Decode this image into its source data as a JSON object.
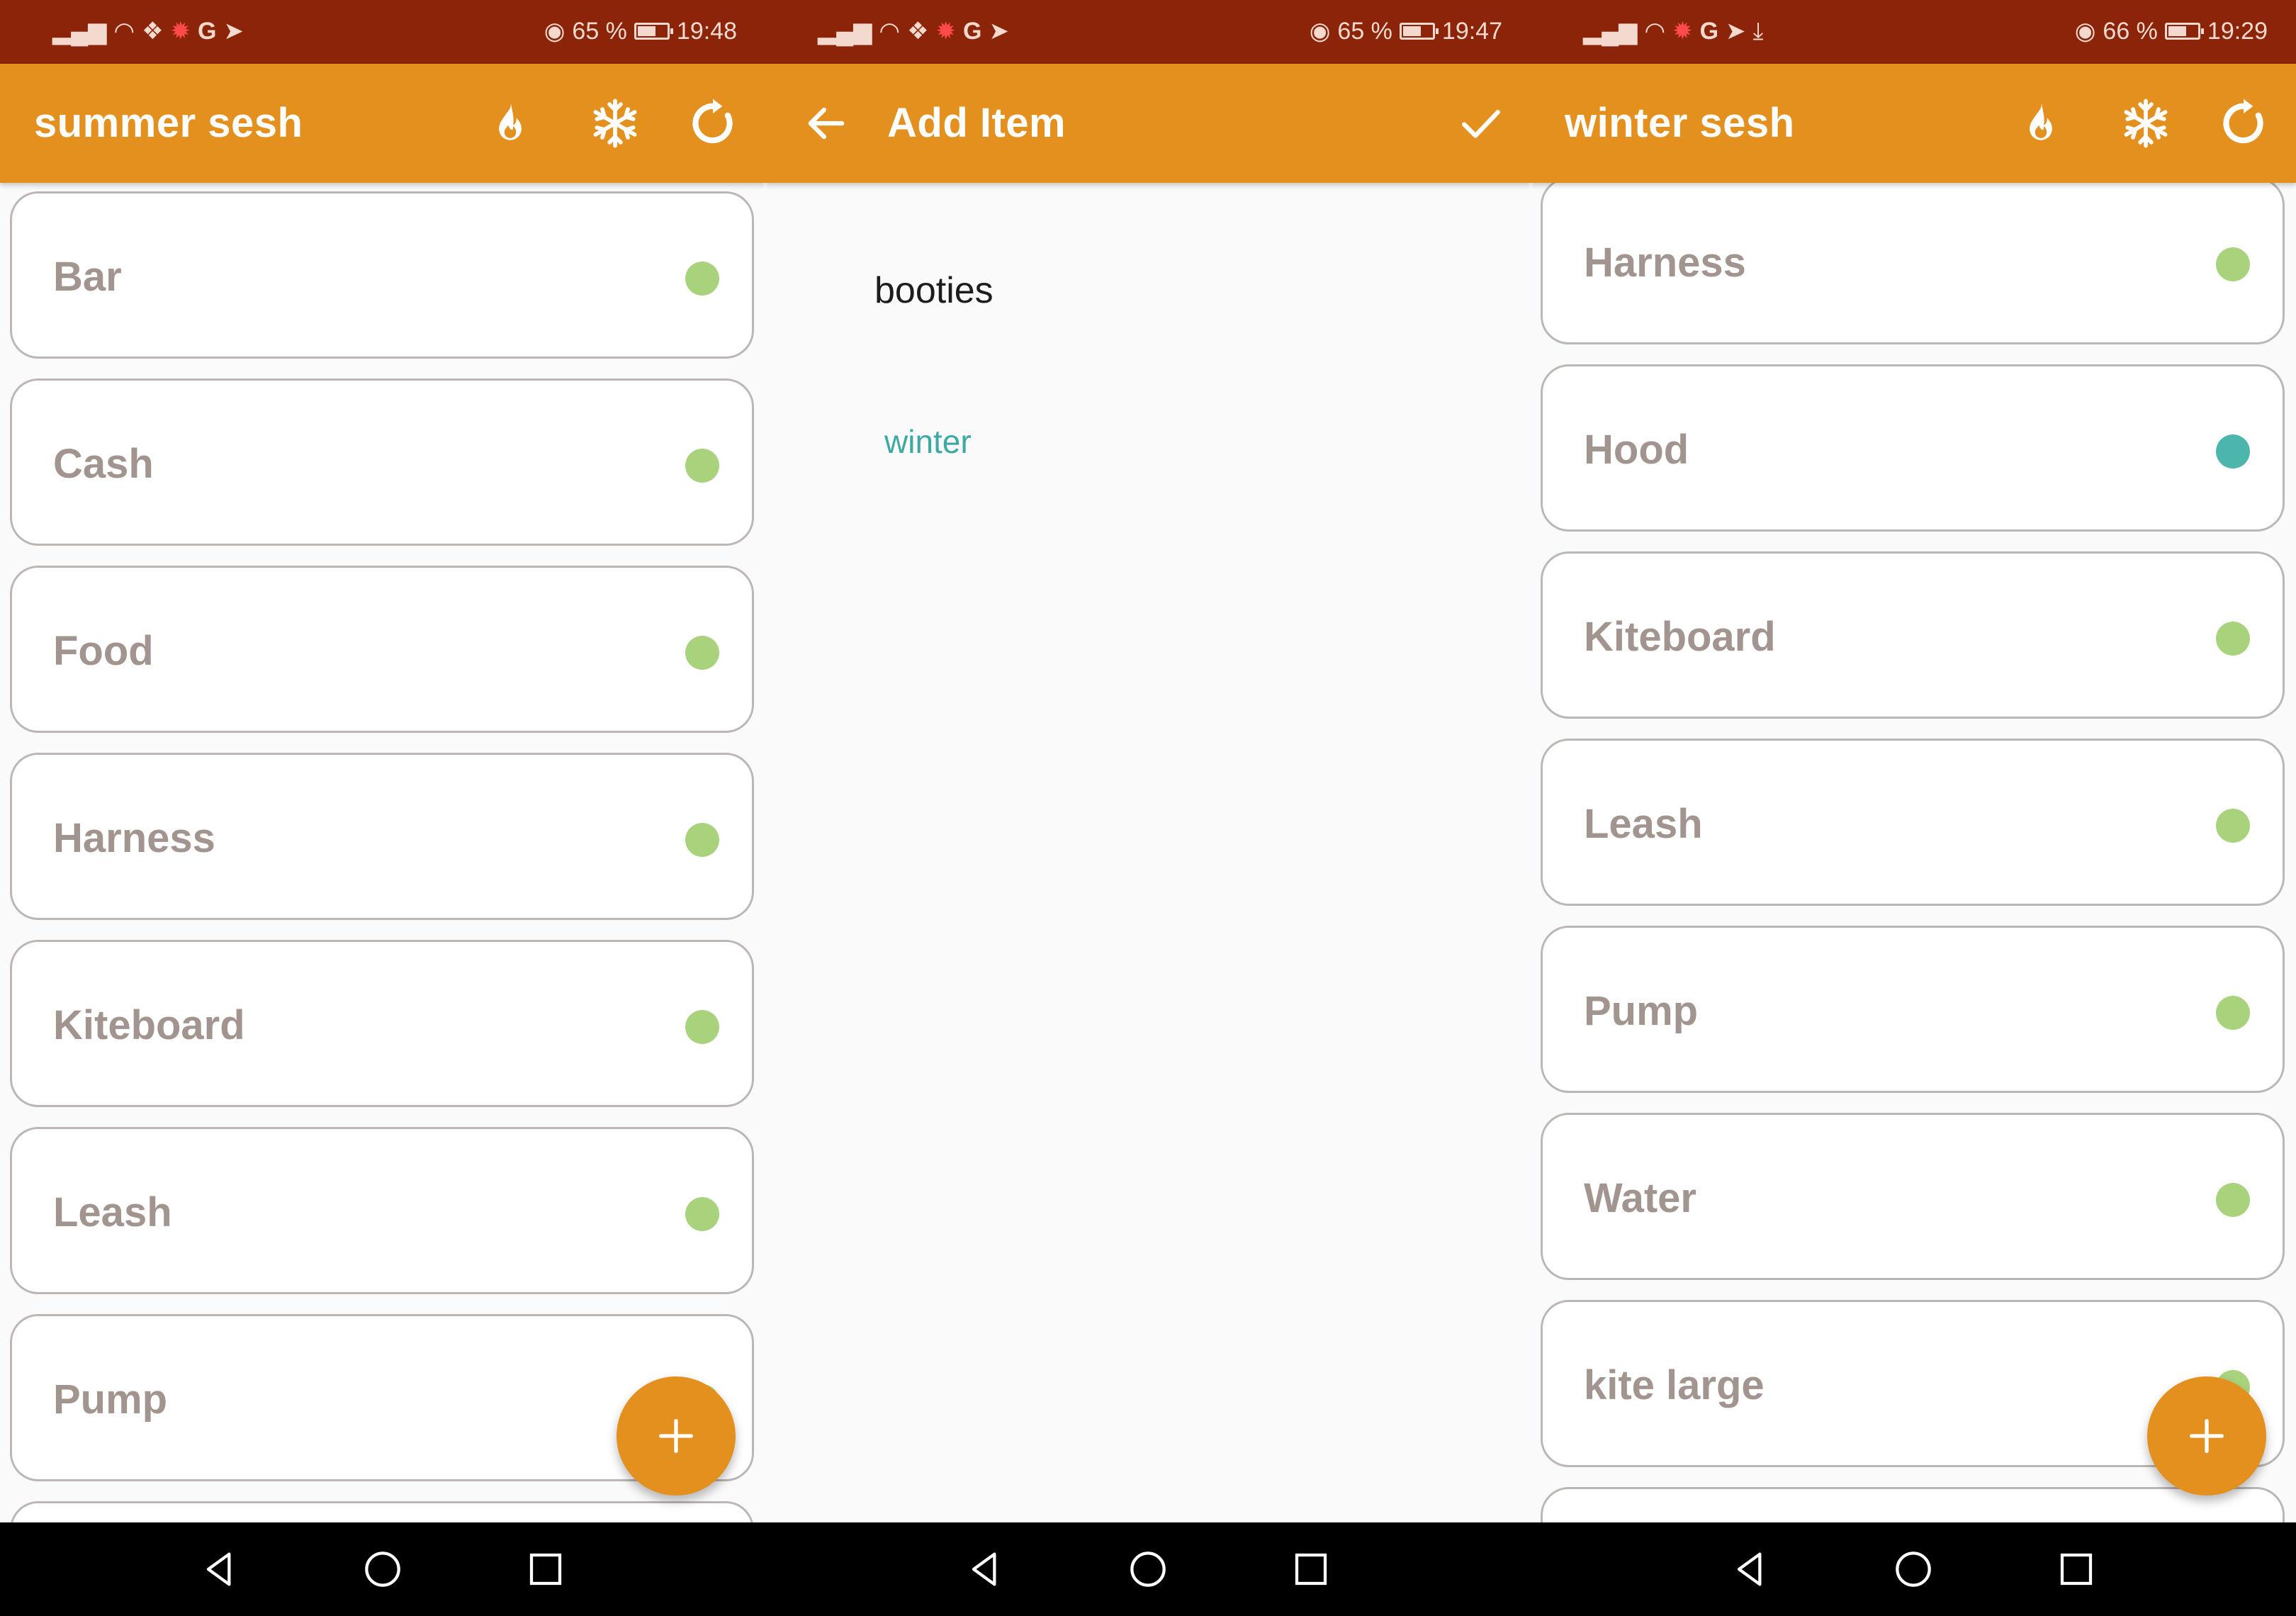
{
  "screens": [
    {
      "status": {
        "battery": "65 %",
        "time": "19:48",
        "battery_level": 0.65
      },
      "toolbar": {
        "title": "summer sesh",
        "actions": [
          "fire-icon",
          "snowflake-icon",
          "refresh-icon"
        ]
      },
      "items": [
        {
          "label": "Bar",
          "dot_color": "#a9d27d"
        },
        {
          "label": "Cash",
          "dot_color": "#a9d27d"
        },
        {
          "label": "Food",
          "dot_color": "#a9d27d"
        },
        {
          "label": "Harness",
          "dot_color": "#a9d27d"
        },
        {
          "label": "Kiteboard",
          "dot_color": "#a9d27d"
        },
        {
          "label": "Leash",
          "dot_color": "#a9d27d"
        },
        {
          "label": "Pump",
          "dot_color": "#a9d27d"
        },
        {
          "label": "",
          "dot_color": "#a9d27d"
        }
      ],
      "fab": {
        "icon": "plus-icon"
      }
    },
    {
      "status": {
        "battery": "65 %",
        "time": "19:47",
        "battery_level": 0.65
      },
      "toolbar": {
        "title": "Add Item",
        "back_icon": "arrow-left-icon",
        "confirm_icon": "check-icon"
      },
      "form": {
        "name": "booties",
        "category": "winter"
      }
    },
    {
      "status": {
        "battery": "66 %",
        "time": "19:29",
        "battery_level": 0.66
      },
      "toolbar": {
        "title": "winter sesh",
        "actions": [
          "fire-icon",
          "snowflake-icon",
          "refresh-icon"
        ]
      },
      "items": [
        {
          "label": "Harness",
          "dot_color": "#a9d27d"
        },
        {
          "label": "Hood",
          "dot_color": "#4db6ac"
        },
        {
          "label": "Kiteboard",
          "dot_color": "#a9d27d"
        },
        {
          "label": "Leash",
          "dot_color": "#a9d27d"
        },
        {
          "label": "Pump",
          "dot_color": "#a9d27d"
        },
        {
          "label": "Water",
          "dot_color": "#a9d27d"
        },
        {
          "label": "kite large",
          "dot_color": "#a9d27d"
        },
        {
          "label": "",
          "dot_color": "#a9d27d"
        }
      ],
      "fab": {
        "icon": "plus-icon"
      }
    }
  ],
  "colors": {
    "status_bar": "#8b2409",
    "toolbar": "#e3901f",
    "fab": "#e3901f",
    "item_text": "#a2958f",
    "category_text": "#3ea9a4"
  },
  "navbar": [
    "back-triangle-icon",
    "home-circle-icon",
    "recents-square-icon"
  ]
}
